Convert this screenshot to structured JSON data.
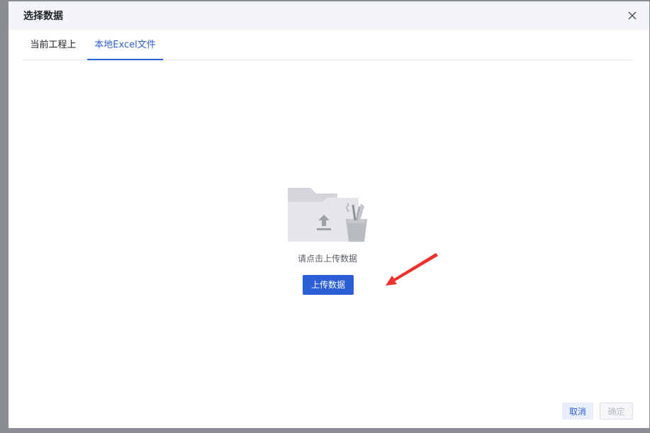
{
  "dialog": {
    "title": "选择数据"
  },
  "tabs": [
    {
      "label": "当前工程上",
      "active": false
    },
    {
      "label": "本地Excel文件",
      "active": true
    }
  ],
  "empty_state": {
    "hint": "请点击上传数据",
    "upload_label": "上传数据",
    "illustration_icon": "folder-upload-icon"
  },
  "annotation": {
    "arrow_color": "#f0302a"
  },
  "footer": {
    "cancel_label": "取消",
    "confirm_label": "确定"
  },
  "colors": {
    "accent": "#2c5fd6",
    "header_bg": "#f3f5f8",
    "overlay": "#8a8d92"
  }
}
